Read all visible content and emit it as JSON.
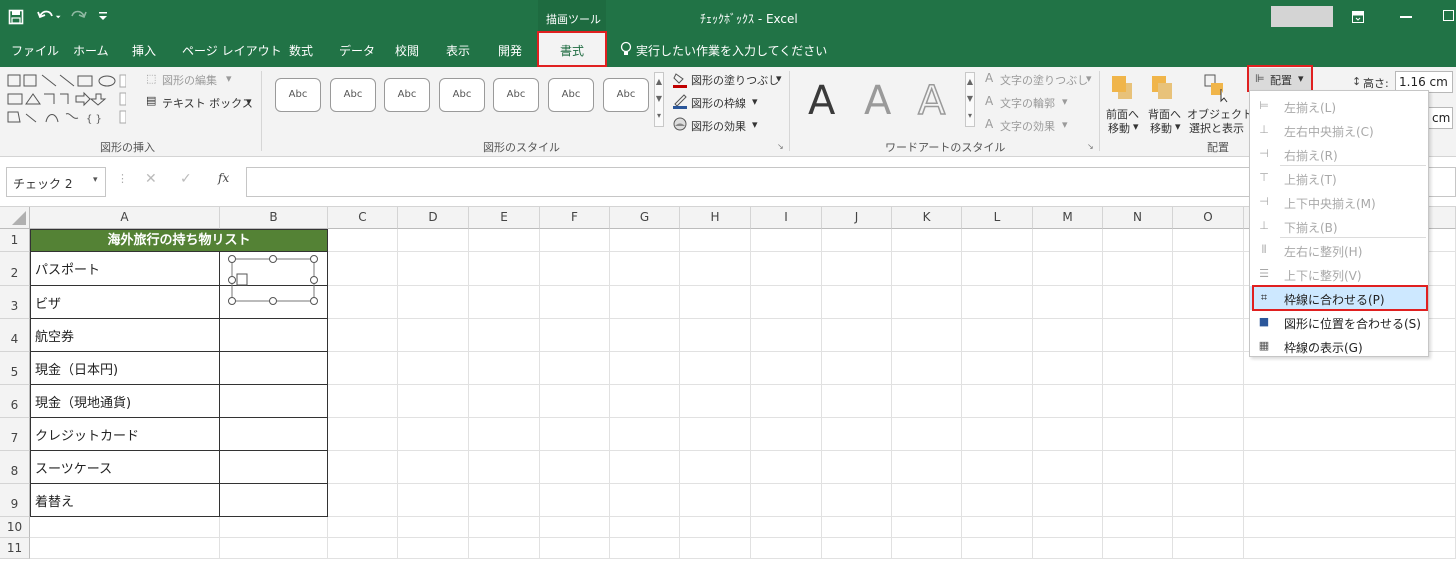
{
  "titlebar": {
    "save_icon": "save-icon",
    "undo_icon": "undo-icon",
    "redo_icon": "redo-icon",
    "qat_icon": "customize-icon",
    "contextual_tab": "描画ツール",
    "title": "ﾁｪｯｸﾎﾞｯｸｽ  -  Excel",
    "ribbon_display_icon": "ribbon-display-icon",
    "minimize_icon": "minimize-icon",
    "maximize_icon": "maximize-icon"
  },
  "tabs": [
    "ファイル",
    "ホーム",
    "挿入",
    "ページ レイアウト",
    "数式",
    "データ",
    "校閲",
    "表示",
    "開発",
    "書式"
  ],
  "tell_me": "実行したい作業を入力してください",
  "ribbon": {
    "shape_insert": {
      "label": "図形の挿入",
      "edit_shape": "図形の編集",
      "text_box": "テキスト ボックス"
    },
    "shape_styles": {
      "label": "図形のスタイル",
      "preset": "Abc",
      "fill": "図形の塗りつぶし",
      "outline": "図形の枠線",
      "effects": "図形の効果"
    },
    "wordart": {
      "label": "ワードアートのスタイル",
      "letter": "A",
      "text_fill": "文字の塗りつぶし",
      "text_outline": "文字の輪郭",
      "text_effects": "文字の効果"
    },
    "arrange": {
      "label": "配置",
      "bring_forward_1": "前面へ",
      "bring_forward_2": "移動",
      "send_backward_1": "背面へ",
      "send_backward_2": "移動",
      "selection_pane_1": "オブジェクトの",
      "selection_pane_2": "選択と表示",
      "align_button": "配置"
    },
    "size": {
      "height_label": "高さ:",
      "height_value": "1.16 cm",
      "width_value": "cm"
    }
  },
  "formula_bar": {
    "name_box": "チェック 2",
    "fx": "fx",
    "formula": ""
  },
  "columns": [
    "A",
    "B",
    "C",
    "D",
    "E",
    "F",
    "G",
    "H",
    "I",
    "J",
    "K",
    "L",
    "M",
    "N",
    "O"
  ],
  "rows": [
    "1",
    "2",
    "3",
    "4",
    "5",
    "6",
    "7",
    "8",
    "9",
    "10",
    "11"
  ],
  "list": {
    "header": "海外旅行の持ち物リスト",
    "items": [
      "パスポート",
      "ビザ",
      "航空券",
      "現金（日本円)",
      "現金（現地通貨)",
      "クレジットカード",
      "スーツケース",
      "着替え"
    ]
  },
  "align_menu": {
    "items": [
      {
        "label": "左揃え(L)",
        "icon": "align-left-icon",
        "enabled": false
      },
      {
        "label": "左右中央揃え(C)",
        "icon": "align-center-icon",
        "enabled": false
      },
      {
        "label": "右揃え(R)",
        "icon": "align-right-icon",
        "enabled": false
      },
      {
        "label": "上揃え(T)",
        "icon": "align-top-icon",
        "enabled": false
      },
      {
        "label": "上下中央揃え(M)",
        "icon": "align-middle-icon",
        "enabled": false
      },
      {
        "label": "下揃え(B)",
        "icon": "align-bottom-icon",
        "enabled": false
      },
      {
        "label": "左右に整列(H)",
        "icon": "distribute-horizontal-icon",
        "enabled": false
      },
      {
        "label": "上下に整列(V)",
        "icon": "distribute-vertical-icon",
        "enabled": false
      },
      {
        "label": "枠線に合わせる(P)",
        "icon": "snap-to-grid-icon",
        "enabled": true
      },
      {
        "label": "図形に位置を合わせる(S)",
        "icon": "snap-to-shape-icon",
        "enabled": true
      },
      {
        "label": "枠線の表示(G)",
        "icon": "view-gridlines-icon",
        "enabled": true
      }
    ]
  },
  "colors": {
    "excel_green": "#217346",
    "header_fill": "#548235",
    "highlight_red": "#e02020",
    "menu_hover": "#cde8ff"
  }
}
